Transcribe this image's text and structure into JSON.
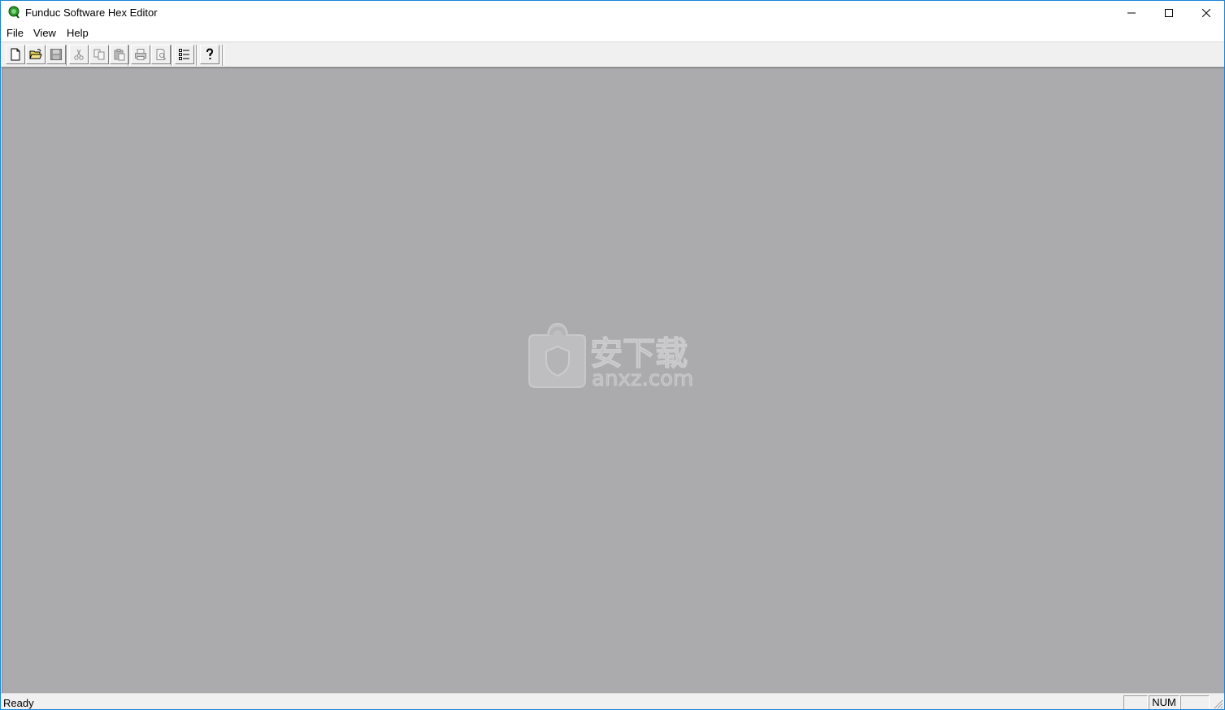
{
  "window": {
    "title": "Funduc Software Hex Editor",
    "icon": "funduc-app-icon",
    "accent_color": "#1883d7",
    "controls": {
      "minimize_icon": "minimize-icon",
      "maximize_icon": "maximize-icon",
      "close_icon": "close-icon"
    }
  },
  "menu": {
    "file": "File",
    "view": "View",
    "help": "Help"
  },
  "toolbar": {
    "buttons": [
      {
        "icon": "new-file-icon",
        "enabled": true
      },
      {
        "icon": "open-folder-icon",
        "enabled": true
      },
      {
        "icon": "save-icon",
        "enabled": false
      },
      {
        "icon": "cut-icon",
        "enabled": false
      },
      {
        "icon": "copy-icon",
        "enabled": false
      },
      {
        "icon": "paste-icon",
        "enabled": false
      },
      {
        "icon": "print-icon",
        "enabled": false
      },
      {
        "icon": "print-preview-icon",
        "enabled": false
      },
      {
        "icon": "options-list-icon",
        "enabled": true
      },
      {
        "icon": "help-icon",
        "enabled": true
      }
    ]
  },
  "client": {
    "background_color": "#abaaad",
    "watermark": {
      "text_cn": "安下载",
      "text_domain": "anxz.com"
    }
  },
  "status": {
    "text": "Ready",
    "panes": [
      "",
      "NUM",
      ""
    ]
  }
}
